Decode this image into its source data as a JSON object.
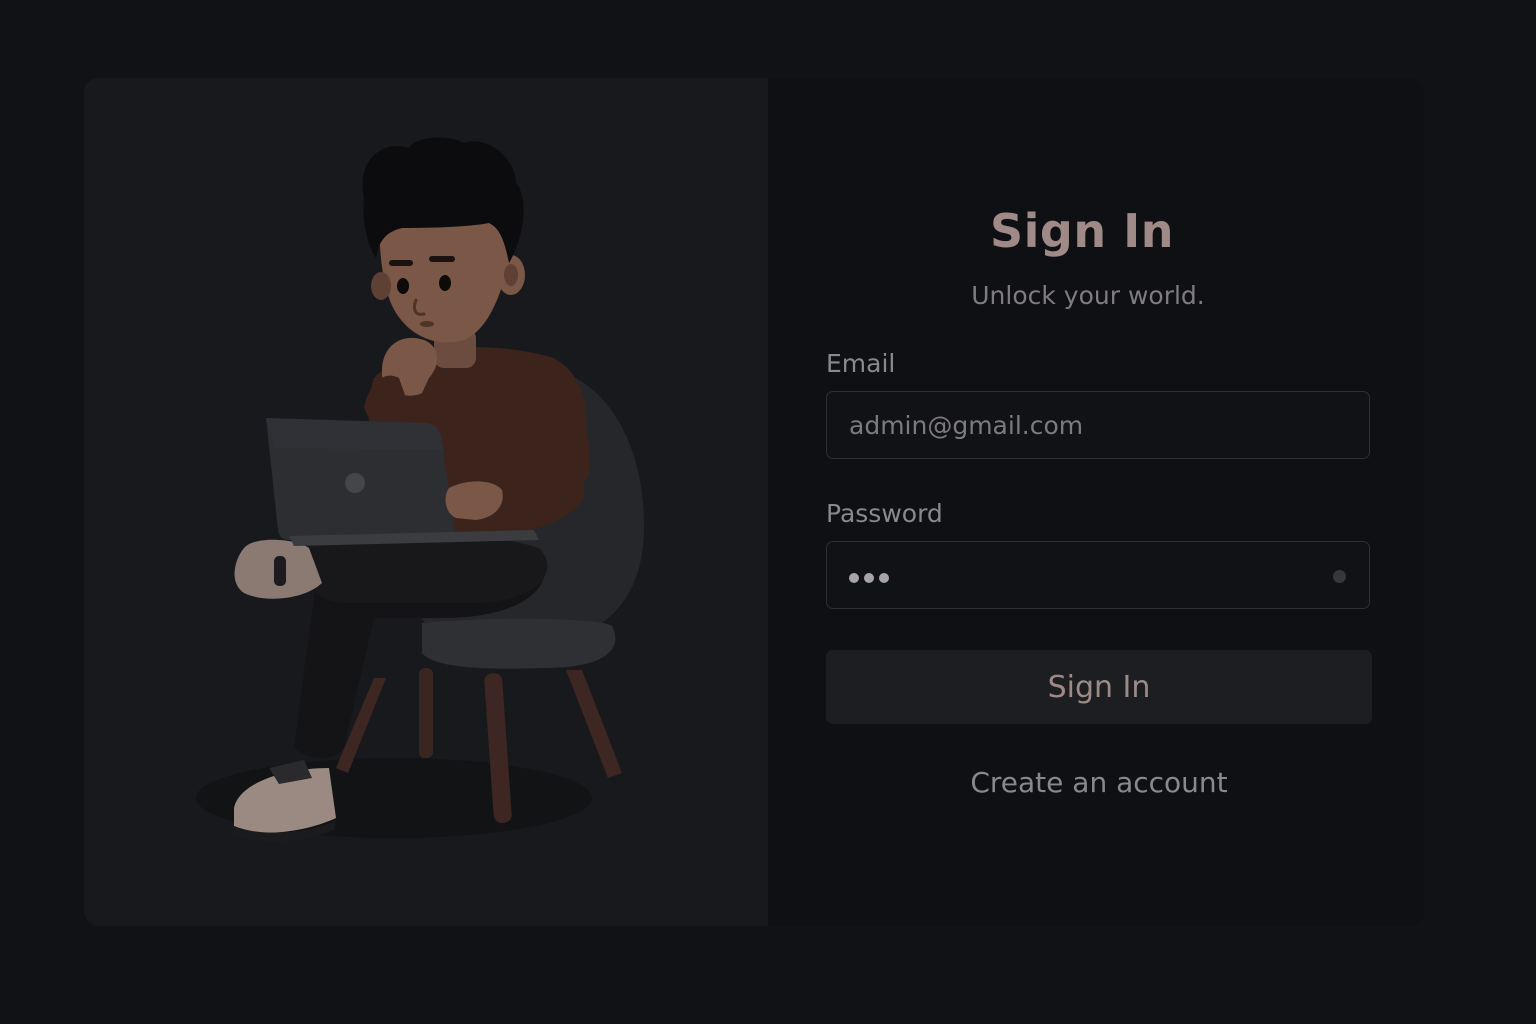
{
  "colors": {
    "background": "#111215",
    "card": "#0f1013",
    "illustration_panel": "#17191c",
    "accent_text": "#9f8a87",
    "muted_text": "#7f7c7e",
    "input_border": "#2d2f33",
    "button": "#1c1e21"
  },
  "illustration": {
    "icon": "person-with-laptop-illustration"
  },
  "form": {
    "title": "Sign In",
    "subtitle": "Unlock your world.",
    "email_label": "Email",
    "email_value": "admin@gmail.com",
    "password_label": "Password",
    "password_masked": "•••",
    "submit_label": "Sign In",
    "create_account_label": "Create an account"
  }
}
